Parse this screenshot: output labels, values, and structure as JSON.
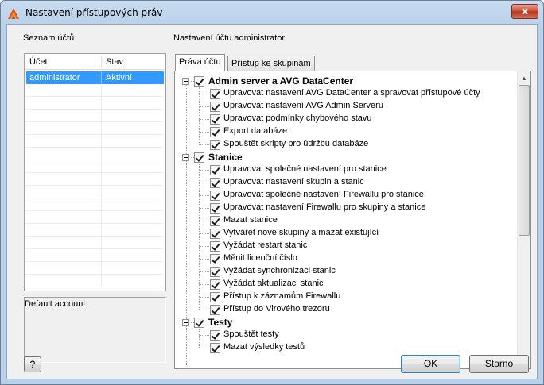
{
  "window": {
    "title": "Nastavení přístupových práv",
    "close_glyph": "x",
    "app_icon": "avg-logo-icon"
  },
  "accounts": {
    "heading": "Seznam účtů",
    "columns": [
      "Účet",
      "Stav"
    ],
    "rows": [
      {
        "name": "administrator",
        "status": "Aktivní",
        "selected": true
      }
    ],
    "description": "Default account"
  },
  "settings": {
    "heading": "Nastavení účtu administrator",
    "tabs": [
      "Práva účtu",
      "Přístup ke skupinám"
    ],
    "active_tab": 0,
    "groups": [
      {
        "label": "Admin server a AVG DataCenter",
        "checked": true,
        "items": [
          "Upravovat nastavení AVG DataCenter a spravovat přístupové účty",
          "Upravovat nastavení AVG Admin Serveru",
          "Upravovat podmínky chybového stavu",
          "Export databáze",
          "Spouštět skripty pro údržbu databáze"
        ]
      },
      {
        "label": "Stanice",
        "checked": true,
        "items": [
          "Upravovat společné nastavení pro stanice",
          "Upravovat nastavení skupin a stanic",
          "Upravovat společné nastavení Firewallu pro stanice",
          "Upravovat nastavení Firewallu pro skupiny a stanice",
          "Mazat stanice",
          "Vytvářet nové skupiny a mazat existující",
          "Vyžádat restart stanic",
          "Měnit licenční číslo",
          "Vyžádat synchronizaci stanic",
          "Vyžádat aktualizaci stanic",
          "Přístup k záznamům Firewallu",
          "Přístup do Virového trezoru"
        ]
      },
      {
        "label": "Testy",
        "checked": true,
        "items": [
          "Spouštět testy",
          "Mazat výsledky testů"
        ]
      }
    ]
  },
  "buttons": {
    "help": "?",
    "ok": "OK",
    "cancel": "Storno"
  },
  "colors": {
    "selection": "#3399ff",
    "dialog_bg": "#f0f0f0",
    "frame": "#b9d1ea"
  }
}
